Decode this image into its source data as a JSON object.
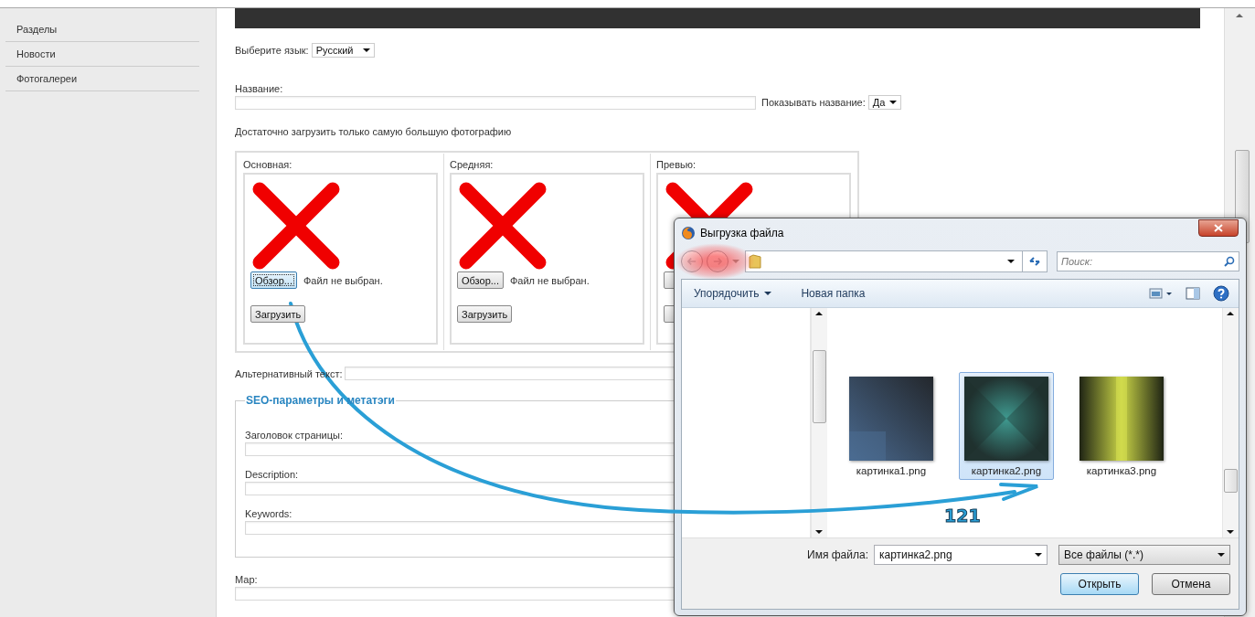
{
  "sidebar": {
    "items": [
      {
        "label": "Разделы"
      },
      {
        "label": "Новости"
      },
      {
        "label": "Фотогалереи"
      }
    ]
  },
  "form": {
    "language": {
      "label": "Выберите язык:",
      "value": "Русский"
    },
    "name": {
      "label": "Название:"
    },
    "show_name": {
      "label": "Показывать название:",
      "value": "Да"
    },
    "note": "Достаточно загрузить только самую большую фотографию",
    "photos": [
      {
        "label": "Основная:",
        "browse": "Обзор...",
        "status": "Файл не выбран.",
        "upload": "Загрузить",
        "focused": true
      },
      {
        "label": "Средняя:",
        "browse": "Обзор...",
        "status": "Файл не выбран.",
        "upload": "Загрузить",
        "focused": false
      },
      {
        "label": "Превью:",
        "focused": false
      }
    ],
    "alt_text": {
      "label": "Альтернативный текст:"
    },
    "seo": {
      "legend": "SEO-параметры и метатэги",
      "fields": [
        {
          "label": "Заголовок страницы:"
        },
        {
          "label": "Description:"
        },
        {
          "label": "Keywords:"
        }
      ]
    },
    "map": {
      "label": "Мар:"
    }
  },
  "dialog": {
    "title": "Выгрузка файла",
    "search": {
      "placeholder": "Поиск:"
    },
    "toolbar": [
      {
        "label": "Упорядочить",
        "kind": "menu"
      },
      {
        "label": "Новая папка",
        "kind": "button"
      }
    ],
    "files": [
      {
        "name": "картинка1.png",
        "selected": false
      },
      {
        "name": "картинка2.png",
        "selected": true
      },
      {
        "name": "картинка3.png",
        "selected": false
      }
    ],
    "filename": {
      "label": "Имя файла:",
      "value": "картинка2.png"
    },
    "filter": {
      "value": "Все файлы (*.*)"
    },
    "buttons": [
      {
        "label": "Открыть",
        "default": true
      },
      {
        "label": "Отмена",
        "default": false
      }
    ]
  },
  "annotation": {
    "label": "121"
  }
}
